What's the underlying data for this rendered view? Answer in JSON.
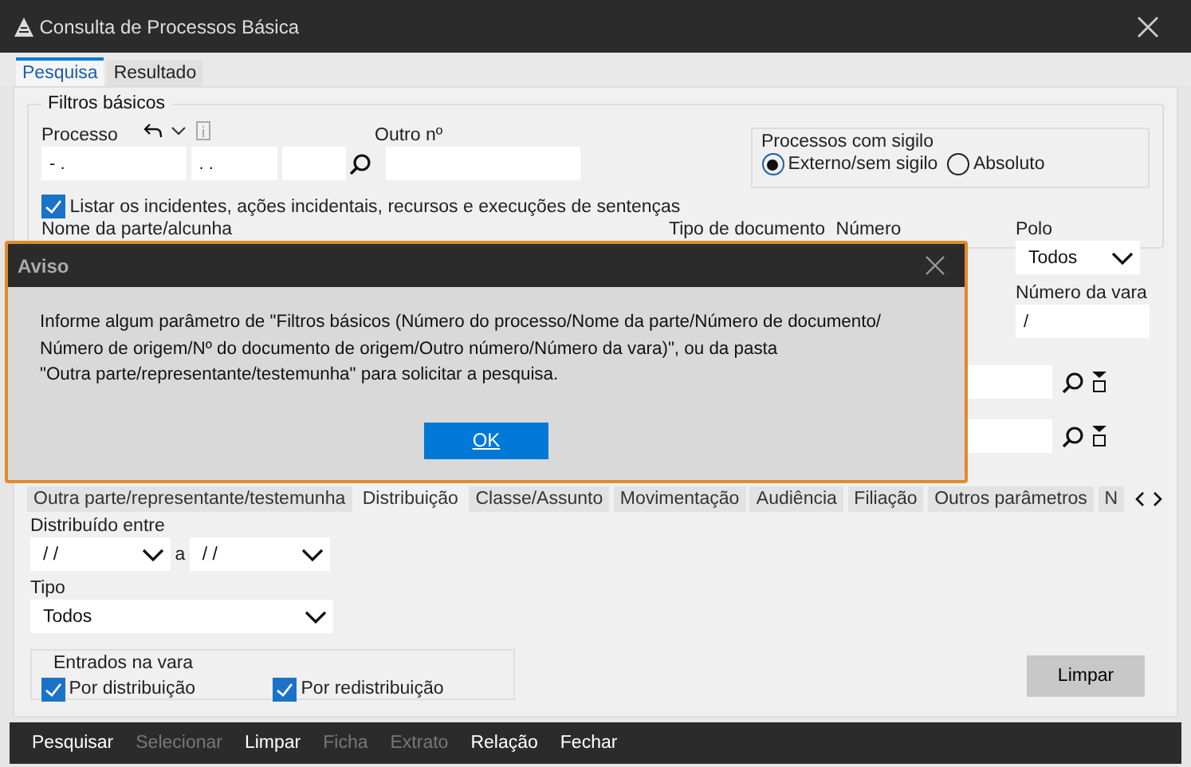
{
  "window": {
    "title": "Consulta de Processos Básica"
  },
  "tabs": [
    {
      "label": "Pesquisa",
      "selected": true
    },
    {
      "label": "Resultado",
      "selected": false
    }
  ],
  "basic_filters": {
    "title": "Filtros básicos",
    "processo_label": "Processo",
    "processo_values": [
      "- .",
      ". ."
    ],
    "other_label": "Outro nº",
    "secrecy": {
      "title": "Processos com sigilo",
      "options": [
        {
          "label": "Externo/sem sigilo",
          "selected": true
        },
        {
          "label": "Absoluto",
          "selected": false
        }
      ]
    },
    "list_incidents": {
      "label": "Listar os incidentes, ações incidentais, recursos e execuções de sentenças",
      "checked": true
    },
    "party_label": "Nome da parte/alcunha",
    "doc_type_label": "Tipo de documento",
    "number_label": "Número",
    "pole_label": "Polo",
    "pole_value": "Todos",
    "court_number_label": "Número da vara",
    "court_number_value": "/"
  },
  "section_tabs": [
    {
      "label": "Outra parte/representante/testemunha",
      "selected": false
    },
    {
      "label": "Distribuição",
      "selected": true
    },
    {
      "label": "Classe/Assunto",
      "selected": false
    },
    {
      "label": "Movimentação",
      "selected": false
    },
    {
      "label": "Audiência",
      "selected": false
    },
    {
      "label": "Filiação",
      "selected": false
    },
    {
      "label": "Outros parâmetros",
      "selected": false
    },
    {
      "label": "N",
      "selected": false
    }
  ],
  "distribution": {
    "range_label": "Distribuído entre",
    "from": "/ /",
    "joiner": "a",
    "to": "/ /",
    "type_label": "Tipo",
    "type_value": "Todos",
    "entries": {
      "title": "Entrados na vara",
      "options": [
        {
          "label": "Por distribuição",
          "checked": true
        },
        {
          "label": "Por redistribuição",
          "checked": true
        }
      ]
    },
    "clear_button": "Limpar"
  },
  "toolbar": [
    {
      "label": "Pesquisar",
      "disabled": false
    },
    {
      "label": "Selecionar",
      "disabled": true
    },
    {
      "label": "Limpar",
      "disabled": false
    },
    {
      "label": "Ficha",
      "disabled": true
    },
    {
      "label": "Extrato",
      "disabled": true
    },
    {
      "label": "Relação",
      "disabled": false
    },
    {
      "label": "Fechar",
      "disabled": false
    }
  ],
  "dialog": {
    "title": "Aviso",
    "message": "Informe algum parâmetro de \"Filtros básicos (Número do processo/Nome da parte/Número de documento/\nNúmero de origem/Nº do documento de origem/Outro número/Número da vara)\", ou da pasta\n\"Outra parte/representante/testemunha\" para solicitar a pesquisa.",
    "button": "OK"
  }
}
